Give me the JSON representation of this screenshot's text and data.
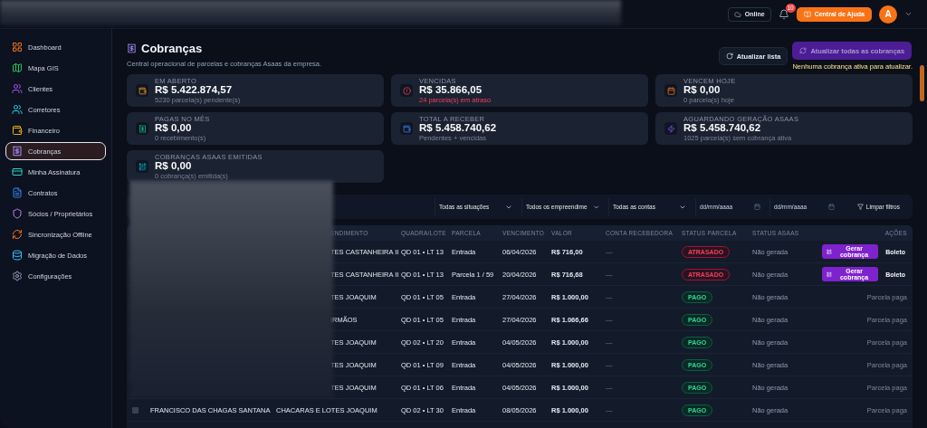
{
  "topbar": {
    "status": "Online",
    "notifications": "10",
    "help": "Central de Ajuda",
    "avatar": "A"
  },
  "sidebar": {
    "items": [
      {
        "label": "Dashboard",
        "selected": false
      },
      {
        "label": "Mapa GIS",
        "selected": false
      },
      {
        "label": "Clientes",
        "selected": false
      },
      {
        "label": "Corretores",
        "selected": false
      },
      {
        "label": "Financeiro",
        "selected": false
      },
      {
        "label": "Cobranças",
        "selected": true
      },
      {
        "label": "Minha Assinatura",
        "selected": false
      },
      {
        "label": "Contratos",
        "selected": false
      },
      {
        "label": "Sócios / Proprietários",
        "selected": false
      },
      {
        "label": "Sincronização Offline",
        "selected": false
      },
      {
        "label": "Migração de Dados",
        "selected": false
      },
      {
        "label": "Configurações",
        "selected": false
      }
    ]
  },
  "header": {
    "title": "Cobranças",
    "subtitle": "Central operacional de parcelas e cobranças Asaas da empresa.",
    "refresh": "Atualizar lista",
    "refresh_all": "Atualizar todas as cobranças",
    "refresh_all_disabled": true,
    "note": "Nenhuma cobrança ativa para atualizar."
  },
  "cards": [
    {
      "label": "EM ABERTO",
      "value": "R$ 5.422.874,57",
      "detail": "5230 parcela(s) pendente(s)",
      "alert": false
    },
    {
      "label": "VENCIDAS",
      "value": "R$ 35.866,05",
      "detail": "24 parcela(s) em atraso",
      "alert": true
    },
    {
      "label": "VENCEM HOJE",
      "value": "R$ 0,00",
      "detail": "0 parcela(s) hoje",
      "alert": false
    },
    {
      "label": "PAGAS NO MÊS",
      "value": "R$ 0,00",
      "detail": "0 recebimento(s)",
      "alert": false
    },
    {
      "label": "TOTAL A RECEBER",
      "value": "R$ 5.458.740,62",
      "detail": "Pendentes + vencidas",
      "alert": false
    },
    {
      "label": "AGUARDANDO GERAÇÃO ASAAS",
      "value": "R$ 5.458.740,62",
      "detail": "1025 parcela(s) sem cobrança ativa",
      "alert": false
    },
    {
      "label": "COBRANÇAS ASAAS EMITIDAS",
      "value": "R$ 0,00",
      "detail": "0 cobrança(s) emitida(s)",
      "alert": false
    }
  ],
  "filters": [
    {
      "kind": "select",
      "text": "Todas as situações"
    },
    {
      "kind": "select",
      "text": "Todos os empreendime"
    },
    {
      "kind": "select",
      "text": "Todas as contas"
    },
    {
      "kind": "date",
      "placeholder": "dd/mm/aaaa"
    },
    {
      "kind": "date",
      "placeholder": "dd/mm/aaaa"
    },
    {
      "kind": "clear",
      "text": "Limpar filtros"
    }
  ],
  "table": {
    "columns": [
      "ENDIMENTO",
      "QUADRA/LOTE",
      "PARCELA",
      "VENCIMENTO",
      "VALOR",
      "CONTA RECEBEDORA",
      "STATUS PARCELA",
      "STATUS ASAAS",
      "AÇÕES"
    ],
    "rows": [
      {
        "project": "TES CASTANHEIRA II",
        "lot": "QD 01 • LT 13",
        "installment": "Entrada",
        "due": "06/04/2026",
        "value": "R$ 716,00",
        "account": "—",
        "status": {
          "label": "ATRASADO",
          "kind": "late"
        },
        "asaas": "Não gerada",
        "action": {
          "kind": "generate",
          "primary": "Gerar cobrança",
          "secondary": "Boleto"
        }
      },
      {
        "project": "TES CASTANHEIRA II",
        "lot": "QD 01 • LT 13",
        "installment": "Parcela 1 / 59",
        "due": "20/04/2026",
        "value": "R$ 716,68",
        "account": "—",
        "status": {
          "label": "ATRASADO",
          "kind": "late"
        },
        "asaas": "Não gerada",
        "action": {
          "kind": "generate",
          "primary": "Gerar cobrança",
          "secondary": "Boleto"
        }
      },
      {
        "project": "TES JOAQUIM",
        "lot": "QD 01 • LT 05",
        "installment": "Entrada",
        "due": "27/04/2026",
        "value": "R$ 1.000,00",
        "account": "—",
        "status": {
          "label": "PAGO",
          "kind": "paid"
        },
        "asaas": "Não gerada",
        "action": {
          "kind": "note",
          "text": "Parcela paga"
        }
      },
      {
        "project": "IRMÃOS",
        "lot": "QD 01 • LT 05",
        "installment": "Entrada",
        "due": "27/04/2026",
        "value": "R$ 1.066,66",
        "account": "—",
        "status": {
          "label": "PAGO",
          "kind": "paid"
        },
        "asaas": "Não gerada",
        "action": {
          "kind": "note",
          "text": "Parcela paga"
        }
      },
      {
        "project": "TES JOAQUIM",
        "lot": "QD 02 • LT 20",
        "installment": "Entrada",
        "due": "04/05/2026",
        "value": "R$ 1.000,00",
        "account": "—",
        "status": {
          "label": "PAGO",
          "kind": "paid"
        },
        "asaas": "Não gerada",
        "action": {
          "kind": "note",
          "text": "Parcela paga"
        }
      },
      {
        "project": "TES JOAQUIM",
        "lot": "QD 01 • LT 09",
        "installment": "Entrada",
        "due": "04/05/2026",
        "value": "R$ 1.000,00",
        "account": "—",
        "status": {
          "label": "PAGO",
          "kind": "paid"
        },
        "asaas": "Não gerada",
        "action": {
          "kind": "note",
          "text": "Parcela paga"
        }
      },
      {
        "project": "TES JOAQUIM",
        "lot": "QD 01 • LT 06",
        "installment": "Entrada",
        "due": "04/05/2026",
        "value": "R$ 1.000,00",
        "account": "—",
        "status": {
          "label": "PAGO",
          "kind": "paid"
        },
        "asaas": "Não gerada",
        "action": {
          "kind": "note",
          "text": "Parcela paga"
        }
      },
      {
        "checked": false,
        "client": "FRANCISCO DAS CHAGAS SANTANA",
        "project": "CHACARAS E LOTES JOAQUIM",
        "lot": "QD 02 • LT 30",
        "installment": "Entrada",
        "due": "08/05/2026",
        "value": "R$ 1.000,00",
        "account": "—",
        "status": {
          "label": "PAGO",
          "kind": "paid"
        },
        "asaas": "Não gerada",
        "action": {
          "kind": "note",
          "text": "Parcela paga"
        }
      }
    ]
  }
}
